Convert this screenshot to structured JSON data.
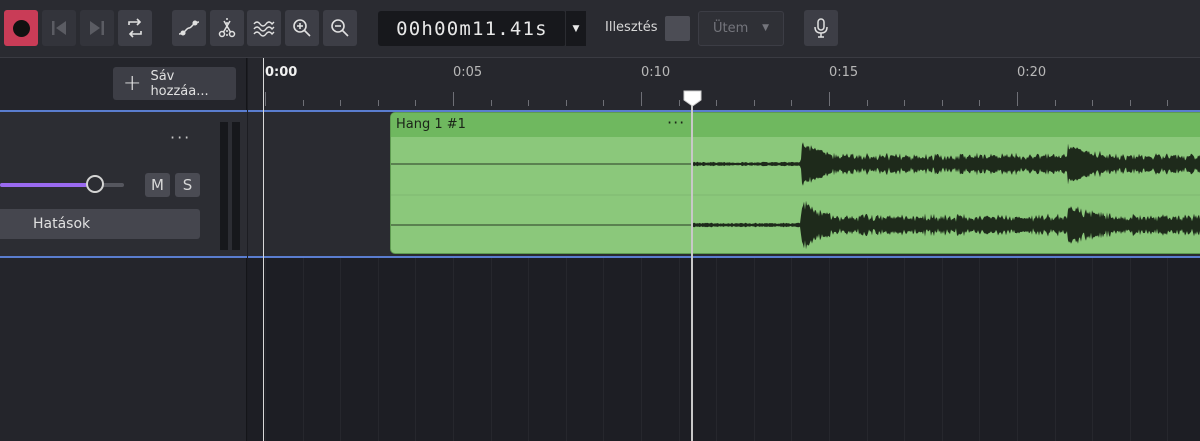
{
  "toolbar": {
    "buttons": [
      {
        "name": "record-button",
        "icon": "record-icon"
      },
      {
        "name": "skip-back-button",
        "icon": "skip-back-icon"
      },
      {
        "name": "skip-forward-button",
        "icon": "skip-forward-icon"
      },
      {
        "name": "loop-button",
        "icon": "loop-icon"
      },
      {
        "name": "automation-button",
        "icon": "automation-curve-icon"
      },
      {
        "name": "split-button",
        "icon": "scissors-icon"
      },
      {
        "name": "fade-button",
        "icon": "waves-icon"
      },
      {
        "name": "zoom-in-button",
        "icon": "zoom-in-icon"
      },
      {
        "name": "zoom-out-button",
        "icon": "zoom-out-icon"
      },
      {
        "name": "microphone-button",
        "icon": "microphone-icon"
      }
    ],
    "time_display": "00h00m11.41s",
    "snap_label": "Illesztés",
    "snap_checked": false,
    "grid_value": "Ütem",
    "accent_record": "#c93c57"
  },
  "tracks_panel": {
    "add_track_label": "Sáv hozzáa...",
    "track": {
      "more_label": "···",
      "volume_level": 0.7,
      "volume_color": "#9a6af0",
      "mute_label": "M",
      "solo_label": "S",
      "effects_label": "Hatások"
    }
  },
  "timeline": {
    "ruler_labels": [
      "0:00",
      "0:05",
      "0:10",
      "0:15",
      "0:20"
    ],
    "playhead_time": "0:11.41",
    "clip": {
      "title": "Hang 1 #1",
      "more_label": "···",
      "color": "#8bc87b",
      "header_color": "#6fb85f"
    },
    "selection_color": "#5a7dcf"
  }
}
